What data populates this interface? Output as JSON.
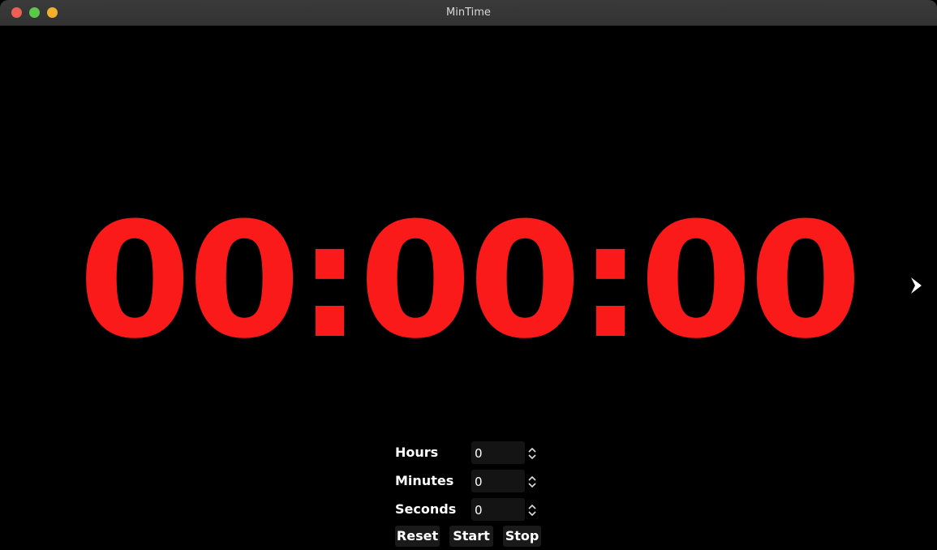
{
  "window": {
    "title": "MinTime"
  },
  "timer": {
    "display": "00:00:00",
    "color": "#fb1a1a"
  },
  "next_icon": "chevron-right-icon",
  "settings": {
    "hours": {
      "label": "Hours",
      "value": "0"
    },
    "minutes": {
      "label": "Minutes",
      "value": "0"
    },
    "seconds": {
      "label": "Seconds",
      "value": "0"
    }
  },
  "buttons": {
    "reset": "Reset",
    "start": "Start",
    "stop": "Stop"
  },
  "colors": {
    "close": "#ec5f57",
    "minimize": "#5cc84a",
    "maximize": "#f2b12c",
    "background": "#000000"
  }
}
